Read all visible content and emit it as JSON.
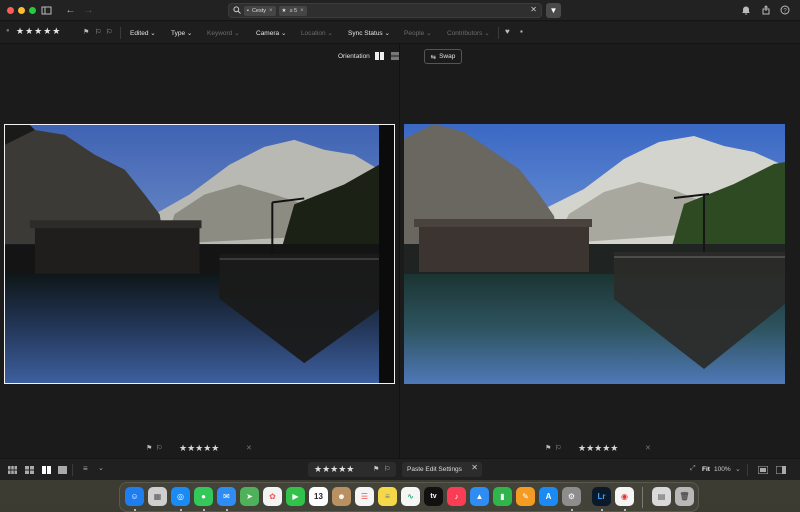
{
  "search": {
    "chips": [
      {
        "label": "Cesty"
      },
      {
        "label": "≥ 5"
      }
    ]
  },
  "filterbar": {
    "stars": "★★★★★",
    "filters": [
      {
        "label": "Edited",
        "enabled": true
      },
      {
        "label": "Type",
        "enabled": true
      },
      {
        "label": "Keyword",
        "enabled": false
      },
      {
        "label": "Camera",
        "enabled": true
      },
      {
        "label": "Location",
        "enabled": false
      },
      {
        "label": "Sync Status",
        "enabled": true
      },
      {
        "label": "People",
        "enabled": false
      },
      {
        "label": "Contributors",
        "enabled": false
      }
    ]
  },
  "compare": {
    "orientation_label": "Orientation",
    "swap_label": "Swap"
  },
  "photos": {
    "left": {
      "stars": "★★★★★",
      "selected": true
    },
    "right": {
      "stars": "★★★★★",
      "selected": false
    }
  },
  "bottombar": {
    "stars": "★★★★★",
    "paste_label": "Paste Edit Settings",
    "fit_label": "Fit",
    "zoom_label": "100%"
  },
  "dock": {
    "apps": [
      {
        "icon": "finder-icon",
        "color": "#1e7ef0"
      },
      {
        "icon": "launchpad-icon",
        "color": "#cfcfcf"
      },
      {
        "icon": "safari-icon",
        "color": "#1a8bf5"
      },
      {
        "icon": "messages-icon",
        "color": "#34c759"
      },
      {
        "icon": "mail-icon",
        "color": "#2f8cf3"
      },
      {
        "icon": "maps-icon",
        "color": "#4fb25b"
      },
      {
        "icon": "photos-icon",
        "color": "#f3f3f3"
      },
      {
        "icon": "facetime-icon",
        "color": "#30c24b"
      },
      {
        "icon": "calendar-icon",
        "color": "#ffffff",
        "text": "13"
      },
      {
        "icon": "contacts-icon",
        "color": "#b99061"
      },
      {
        "icon": "reminders-icon",
        "color": "#f5f5f5"
      },
      {
        "icon": "notes-icon",
        "color": "#f5d84a"
      },
      {
        "icon": "freeform-icon",
        "color": "#f5f5f5"
      },
      {
        "icon": "tv-icon",
        "color": "#111111",
        "text": "tv"
      },
      {
        "icon": "music-icon",
        "color": "#fa3c55"
      },
      {
        "icon": "keynote-icon",
        "color": "#2f8cf3"
      },
      {
        "icon": "numbers-icon",
        "color": "#2fb54c"
      },
      {
        "icon": "pages-icon",
        "color": "#f49b24"
      },
      {
        "icon": "app-store-icon",
        "color": "#1a8bf5"
      },
      {
        "icon": "system-settings-icon",
        "color": "#8d8d8d"
      },
      {
        "icon": "lightroom-icon",
        "color": "#0b1a2b",
        "text": "Lr"
      },
      {
        "icon": "chrome-icon",
        "color": "#f5f5f5"
      },
      {
        "icon": "preview-icon",
        "color": "#d9d9d9"
      },
      {
        "icon": "trash-icon",
        "color": "#b8b8b8"
      }
    ]
  }
}
